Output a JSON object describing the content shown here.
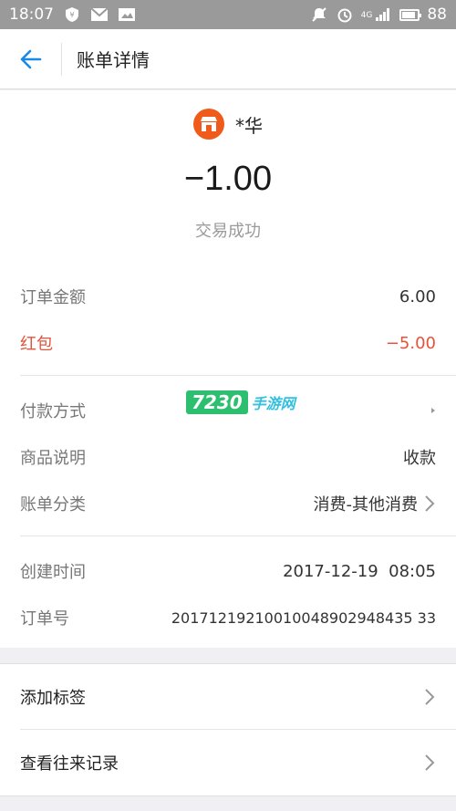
{
  "status_bar": {
    "time": "18:07",
    "network": "4G",
    "battery": "88",
    "battery_level": 0.88
  },
  "nav": {
    "title": "账单详情"
  },
  "merchant": {
    "name": "*华"
  },
  "amount": "−1.00",
  "status": "交易成功",
  "rows": [
    {
      "label": "订单金额",
      "value": "6.00"
    },
    {
      "label": "红包",
      "value": "−5.00"
    },
    {
      "label": "付款方式",
      "value": ""
    },
    {
      "label": "商品说明",
      "value": "收款"
    },
    {
      "label": "账单分类",
      "value": "消费-其他消费"
    },
    {
      "label": "创建时间",
      "value": "2017-12-19  08:05"
    },
    {
      "label": "订单号",
      "value": "20171219210010048902948435 33"
    }
  ],
  "actions": [
    {
      "label": "添加标签"
    },
    {
      "label": "查看往来记录"
    }
  ],
  "watermark": {
    "num": "7230",
    "text": "手游网"
  },
  "colors": {
    "accent": "#1a8ae6",
    "negative": "#e5523b",
    "merchant_logo": "#f05a1a"
  }
}
